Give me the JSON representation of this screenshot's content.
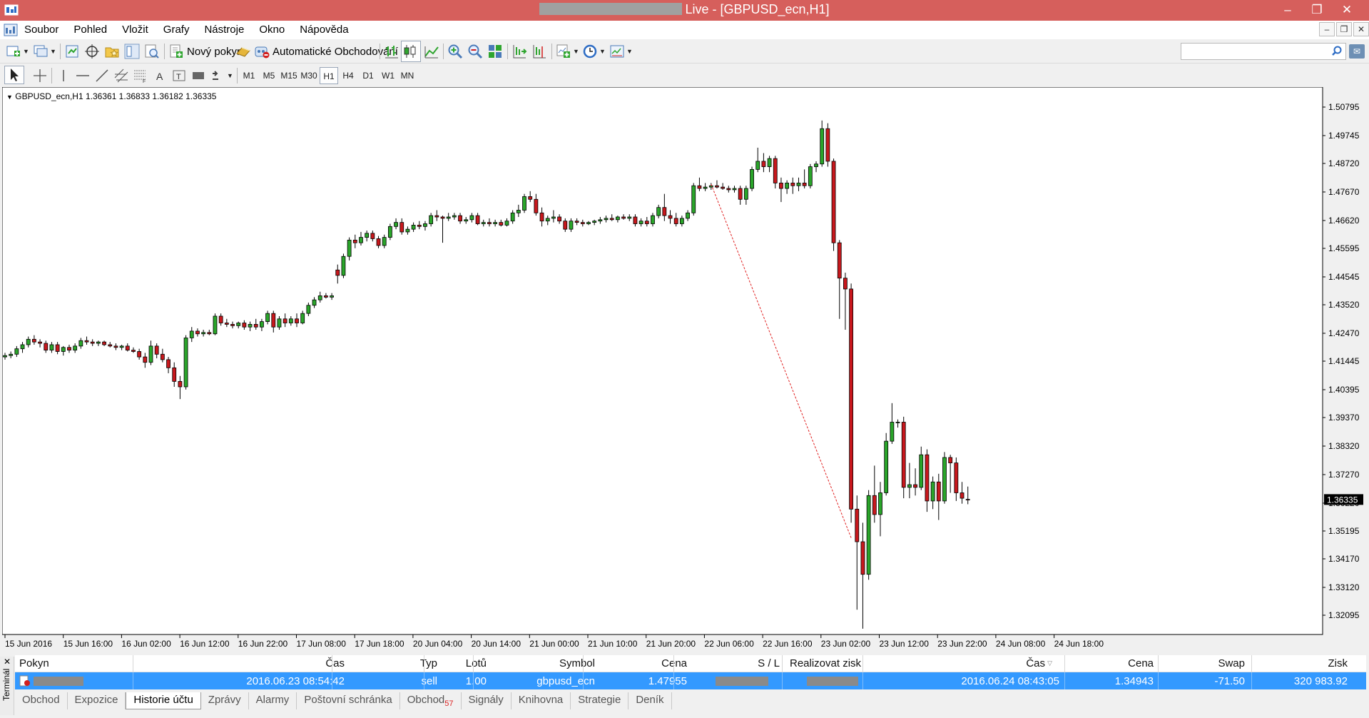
{
  "window": {
    "title": "Live - [GBPUSD_ecn,H1]",
    "minimize_icon": "minimize-icon",
    "maximize_icon": "maximize-icon",
    "close_icon": "close-icon"
  },
  "menu": [
    "Soubor",
    "Pohled",
    "Vložit",
    "Grafy",
    "Nástroje",
    "Okno",
    "Nápověda"
  ],
  "toolbar": {
    "new_order_label": "Nový pokyn",
    "autotrading_label": "Automatické Obchodování"
  },
  "timeframes": [
    "M1",
    "M5",
    "M15",
    "M30",
    "H1",
    "H4",
    "D1",
    "W1",
    "MN"
  ],
  "active_timeframe": "H1",
  "chart": {
    "info": "GBPUSD_ecn,H1  1.36361 1.36833 1.36182 1.36335",
    "current_price_label": "1.36335",
    "colors": {
      "bull": "#2aa52a",
      "bear": "#c8181d",
      "wick": "#000000",
      "trade_line": "#e02020",
      "price_tag_bg": "#000000"
    }
  },
  "chart_data": {
    "type": "candlestick",
    "symbol": "GBPUSD_ecn",
    "timeframe": "H1",
    "ylim": [
      1.3157,
      1.5132
    ],
    "y_ticks": [
      "1.50795",
      "1.49745",
      "1.48720",
      "1.47670",
      "1.46620",
      "1.45595",
      "1.44545",
      "1.43520",
      "1.42470",
      "1.41445",
      "1.40395",
      "1.39370",
      "1.38320",
      "1.37270",
      "1.36220",
      "1.35195",
      "1.34170",
      "1.33120",
      "1.32095"
    ],
    "x_ticks": [
      "15 Jun 2016",
      "15 Jun 16:00",
      "16 Jun 02:00",
      "16 Jun 12:00",
      "16 Jun 22:00",
      "17 Jun 08:00",
      "17 Jun 18:00",
      "20 Jun 04:00",
      "20 Jun 14:00",
      "21 Jun 00:00",
      "21 Jun 10:00",
      "21 Jun 20:00",
      "22 Jun 06:00",
      "22 Jun 16:00",
      "23 Jun 02:00",
      "23 Jun 12:00",
      "23 Jun 22:00",
      "24 Jun 08:00",
      "24 Jun 18:00"
    ],
    "candles": [
      [
        1.416,
        1.4175,
        1.415,
        1.4165
      ],
      [
        1.4165,
        1.418,
        1.4155,
        1.417
      ],
      [
        1.417,
        1.42,
        1.416,
        1.419
      ],
      [
        1.419,
        1.4215,
        1.4175,
        1.4205
      ],
      [
        1.4205,
        1.4235,
        1.4195,
        1.4225
      ],
      [
        1.4225,
        1.424,
        1.4205,
        1.4215
      ],
      [
        1.4215,
        1.4225,
        1.4195,
        1.421
      ],
      [
        1.421,
        1.422,
        1.4175,
        1.4185
      ],
      [
        1.4185,
        1.4215,
        1.4175,
        1.4205
      ],
      [
        1.4205,
        1.4215,
        1.417,
        1.418
      ],
      [
        1.418,
        1.42,
        1.4165,
        1.4195
      ],
      [
        1.4195,
        1.4205,
        1.4175,
        1.4185
      ],
      [
        1.4185,
        1.421,
        1.4175,
        1.42
      ],
      [
        1.42,
        1.423,
        1.419,
        1.422
      ],
      [
        1.422,
        1.4235,
        1.4205,
        1.4215
      ],
      [
        1.4215,
        1.4225,
        1.42,
        1.421
      ],
      [
        1.421,
        1.422,
        1.42,
        1.4215
      ],
      [
        1.4215,
        1.422,
        1.42,
        1.4205
      ],
      [
        1.4205,
        1.4215,
        1.4195,
        1.42
      ],
      [
        1.42,
        1.421,
        1.4185,
        1.4195
      ],
      [
        1.4195,
        1.4205,
        1.4185,
        1.42
      ],
      [
        1.42,
        1.421,
        1.418,
        1.4185
      ],
      [
        1.4185,
        1.4195,
        1.4175,
        1.418
      ],
      [
        1.418,
        1.419,
        1.415,
        1.416
      ],
      [
        1.416,
        1.4175,
        1.412,
        1.414
      ],
      [
        1.414,
        1.422,
        1.413,
        1.42
      ],
      [
        1.42,
        1.421,
        1.4155,
        1.417
      ],
      [
        1.417,
        1.419,
        1.414,
        1.415
      ],
      [
        1.415,
        1.416,
        1.41,
        1.412
      ],
      [
        1.412,
        1.414,
        1.405,
        1.407
      ],
      [
        1.407,
        1.409,
        1.4005,
        1.405
      ],
      [
        1.405,
        1.424,
        1.404,
        1.423
      ],
      [
        1.423,
        1.427,
        1.4215,
        1.4255
      ],
      [
        1.4255,
        1.4265,
        1.4235,
        1.4245
      ],
      [
        1.4245,
        1.426,
        1.4235,
        1.425
      ],
      [
        1.425,
        1.426,
        1.424,
        1.4245
      ],
      [
        1.4245,
        1.432,
        1.424,
        1.431
      ],
      [
        1.431,
        1.432,
        1.4275,
        1.4285
      ],
      [
        1.4285,
        1.43,
        1.427,
        1.428
      ],
      [
        1.428,
        1.429,
        1.4265,
        1.4275
      ],
      [
        1.4275,
        1.429,
        1.4265,
        1.4285
      ],
      [
        1.4285,
        1.4295,
        1.426,
        1.427
      ],
      [
        1.427,
        1.429,
        1.4255,
        1.428
      ],
      [
        1.428,
        1.43,
        1.426,
        1.427
      ],
      [
        1.427,
        1.43,
        1.4255,
        1.429
      ],
      [
        1.429,
        1.433,
        1.428,
        1.432
      ],
      [
        1.432,
        1.433,
        1.425,
        1.427
      ],
      [
        1.427,
        1.431,
        1.426,
        1.43
      ],
      [
        1.43,
        1.432,
        1.427,
        1.4285
      ],
      [
        1.4285,
        1.431,
        1.4275,
        1.43
      ],
      [
        1.43,
        1.432,
        1.427,
        1.4285
      ],
      [
        1.4285,
        1.433,
        1.428,
        1.432
      ],
      [
        1.432,
        1.436,
        1.431,
        1.435
      ],
      [
        1.435,
        1.438,
        1.434,
        1.437
      ],
      [
        1.437,
        1.44,
        1.436,
        1.4385
      ],
      [
        1.4385,
        1.4395,
        1.4375,
        1.438
      ],
      [
        1.438,
        1.4395,
        1.437,
        1.4385
      ],
      [
        1.448,
        1.45,
        1.443,
        1.446
      ],
      [
        1.446,
        1.454,
        1.445,
        1.453
      ],
      [
        1.453,
        1.46,
        1.4515,
        1.459
      ],
      [
        1.459,
        1.461,
        1.456,
        1.458
      ],
      [
        1.458,
        1.462,
        1.457,
        1.46
      ],
      [
        1.46,
        1.4625,
        1.4585,
        1.4615
      ],
      [
        1.4615,
        1.4625,
        1.4585,
        1.4595
      ],
      [
        1.4595,
        1.4605,
        1.456,
        1.457
      ],
      [
        1.457,
        1.461,
        1.456,
        1.46
      ],
      [
        1.46,
        1.465,
        1.459,
        1.464
      ],
      [
        1.464,
        1.467,
        1.463,
        1.4655
      ],
      [
        1.4655,
        1.467,
        1.461,
        1.462
      ],
      [
        1.462,
        1.464,
        1.461,
        1.463
      ],
      [
        1.463,
        1.4655,
        1.462,
        1.4645
      ],
      [
        1.4645,
        1.466,
        1.463,
        1.464
      ],
      [
        1.464,
        1.466,
        1.4625,
        1.465
      ],
      [
        1.465,
        1.469,
        1.464,
        1.468
      ],
      [
        1.468,
        1.47,
        1.466,
        1.4675
      ],
      [
        1.4675,
        1.468,
        1.458,
        1.467
      ],
      [
        1.467,
        1.469,
        1.466,
        1.4675
      ],
      [
        1.4675,
        1.469,
        1.4665,
        1.468
      ],
      [
        1.468,
        1.469,
        1.465,
        1.466
      ],
      [
        1.466,
        1.4675,
        1.465,
        1.4665
      ],
      [
        1.4665,
        1.469,
        1.4655,
        1.468
      ],
      [
        1.468,
        1.469,
        1.4645,
        1.465
      ],
      [
        1.465,
        1.4665,
        1.464,
        1.4655
      ],
      [
        1.4655,
        1.467,
        1.464,
        1.465
      ],
      [
        1.465,
        1.4665,
        1.464,
        1.4655
      ],
      [
        1.4655,
        1.4665,
        1.464,
        1.4645
      ],
      [
        1.4645,
        1.467,
        1.464,
        1.466
      ],
      [
        1.466,
        1.47,
        1.465,
        1.469
      ],
      [
        1.469,
        1.472,
        1.4675,
        1.47
      ],
      [
        1.47,
        1.476,
        1.469,
        1.475
      ],
      [
        1.475,
        1.477,
        1.473,
        1.474
      ],
      [
        1.474,
        1.476,
        1.468,
        1.469
      ],
      [
        1.469,
        1.471,
        1.464,
        1.466
      ],
      [
        1.466,
        1.468,
        1.4645,
        1.467
      ],
      [
        1.467,
        1.47,
        1.4655,
        1.4675
      ],
      [
        1.4675,
        1.4685,
        1.465,
        1.466
      ],
      [
        1.466,
        1.467,
        1.462,
        1.463
      ],
      [
        1.463,
        1.467,
        1.462,
        1.466
      ],
      [
        1.466,
        1.467,
        1.4645,
        1.4655
      ],
      [
        1.4655,
        1.4665,
        1.464,
        1.465
      ],
      [
        1.465,
        1.466,
        1.4645,
        1.4655
      ],
      [
        1.4655,
        1.4665,
        1.4645,
        1.466
      ],
      [
        1.466,
        1.4675,
        1.465,
        1.4665
      ],
      [
        1.4665,
        1.468,
        1.4655,
        1.467
      ],
      [
        1.467,
        1.4685,
        1.466,
        1.4665
      ],
      [
        1.4665,
        1.468,
        1.4655,
        1.4675
      ],
      [
        1.4675,
        1.4685,
        1.4665,
        1.467
      ],
      [
        1.467,
        1.4685,
        1.466,
        1.4675
      ],
      [
        1.4675,
        1.4685,
        1.464,
        1.465
      ],
      [
        1.465,
        1.467,
        1.464,
        1.466
      ],
      [
        1.466,
        1.4675,
        1.464,
        1.465
      ],
      [
        1.465,
        1.469,
        1.464,
        1.468
      ],
      [
        1.468,
        1.472,
        1.467,
        1.471
      ],
      [
        1.471,
        1.476,
        1.466,
        1.468
      ],
      [
        1.468,
        1.47,
        1.465,
        1.467
      ],
      [
        1.467,
        1.469,
        1.464,
        1.465
      ],
      [
        1.465,
        1.468,
        1.464,
        1.467
      ],
      [
        1.467,
        1.47,
        1.466,
        1.469
      ],
      [
        1.469,
        1.48,
        1.468,
        1.479
      ],
      [
        1.479,
        1.482,
        1.477,
        1.478
      ],
      [
        1.478,
        1.48,
        1.477,
        1.4785
      ],
      [
        1.4785,
        1.48,
        1.4775,
        1.479
      ],
      [
        1.479,
        1.481,
        1.478,
        1.4785
      ],
      [
        1.4785,
        1.48,
        1.4775,
        1.478
      ],
      [
        1.478,
        1.479,
        1.4765,
        1.4775
      ],
      [
        1.4775,
        1.479,
        1.4765,
        1.478
      ],
      [
        1.478,
        1.479,
        1.472,
        1.474
      ],
      [
        1.474,
        1.479,
        1.472,
        1.478
      ],
      [
        1.478,
        1.486,
        1.477,
        1.485
      ],
      [
        1.485,
        1.493,
        1.484,
        1.488
      ],
      [
        1.488,
        1.491,
        1.484,
        1.486
      ],
      [
        1.486,
        1.49,
        1.484,
        1.489
      ],
      [
        1.489,
        1.49,
        1.478,
        1.48
      ],
      [
        1.48,
        1.482,
        1.473,
        1.478
      ],
      [
        1.478,
        1.481,
        1.476,
        1.48
      ],
      [
        1.48,
        1.482,
        1.476,
        1.479
      ],
      [
        1.479,
        1.482,
        1.477,
        1.48
      ],
      [
        1.48,
        1.485,
        1.478,
        1.479
      ],
      [
        1.479,
        1.487,
        1.478,
        1.486
      ],
      [
        1.486,
        1.488,
        1.484,
        1.487
      ],
      [
        1.487,
        1.503,
        1.486,
        1.5
      ],
      [
        1.5,
        1.502,
        1.486,
        1.488
      ],
      [
        1.488,
        1.489,
        1.455,
        1.458
      ],
      [
        1.458,
        1.459,
        1.43,
        1.445
      ],
      [
        1.445,
        1.447,
        1.426,
        1.441
      ],
      [
        1.441,
        1.443,
        1.355,
        1.36
      ],
      [
        1.36,
        1.365,
        1.323,
        1.348
      ],
      [
        1.348,
        1.355,
        1.316,
        1.336
      ],
      [
        1.336,
        1.367,
        1.334,
        1.365
      ],
      [
        1.365,
        1.376,
        1.355,
        1.358
      ],
      [
        1.358,
        1.37,
        1.35,
        1.366
      ],
      [
        1.366,
        1.388,
        1.365,
        1.385
      ],
      [
        1.385,
        1.399,
        1.384,
        1.392
      ],
      [
        1.392,
        1.393,
        1.39,
        1.392
      ],
      [
        1.392,
        1.394,
        1.364,
        1.368
      ],
      [
        1.368,
        1.377,
        1.364,
        1.369
      ],
      [
        1.369,
        1.375,
        1.365,
        1.368
      ],
      [
        1.368,
        1.383,
        1.367,
        1.38
      ],
      [
        1.38,
        1.382,
        1.359,
        1.363
      ],
      [
        1.363,
        1.372,
        1.36,
        1.37
      ],
      [
        1.37,
        1.373,
        1.356,
        1.363
      ],
      [
        1.363,
        1.381,
        1.362,
        1.379
      ],
      [
        1.379,
        1.38,
        1.366,
        1.377
      ],
      [
        1.377,
        1.379,
        1.363,
        1.366
      ],
      [
        1.366,
        1.37,
        1.362,
        1.364
      ],
      [
        1.3636,
        1.3683,
        1.3618,
        1.3634
      ]
    ],
    "trade_line": {
      "from": [
        121,
        1.47955
      ],
      "to": [
        145,
        1.34943
      ]
    }
  },
  "terminal": {
    "side_label": "Terminál",
    "headers": {
      "pokyn": "Pokyn",
      "cas": "Čas",
      "typ": "Typ",
      "lotu": "Lotů",
      "symbol": "Symbol",
      "cena": "Cena",
      "sl": "S / L",
      "tp": "Realizovat zisk",
      "cas2": "Čas",
      "cena2": "Cena",
      "swap": "Swap",
      "zisk": "Zisk"
    },
    "row": {
      "open_time": "2016.06.23 08:54:42",
      "type": "sell",
      "lots": "1.00",
      "symbol": "gbpusd_ecn",
      "open_price": "1.47955",
      "close_time": "2016.06.24 08:43:05",
      "close_price": "1.34943",
      "swap": "-71.50",
      "profit": "320 983.92"
    },
    "tabs": [
      "Obchod",
      "Expozice",
      "Historie účtu",
      "Zprávy",
      "Alarmy",
      "Poštovní schránka",
      "Obchod",
      "Signály",
      "Knihovna",
      "Strategie",
      "Deník"
    ],
    "tab_badge": "57",
    "active_tab": "Historie účtu"
  }
}
